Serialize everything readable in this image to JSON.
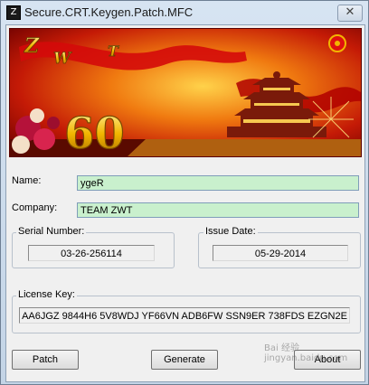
{
  "window": {
    "title": "Secure.CRT.Keygen.Patch.MFC",
    "close_glyph": "✕"
  },
  "banner": {
    "letters": [
      "Z",
      "W",
      "T"
    ],
    "big_number": "60"
  },
  "fields": {
    "name_label": "Name:",
    "name_value": "ygeR",
    "company_label": "Company:",
    "company_value": "TEAM ZWT"
  },
  "serial": {
    "label": "Serial Number:",
    "value": "03-26-256114"
  },
  "issue": {
    "label": "Issue Date:",
    "value": "05-29-2014"
  },
  "license": {
    "label": "License Key:",
    "value": "AA6JGZ 9844H6 5V8WDJ YF66VN ADB6FW SSN9ER 738FDS EZGN2E"
  },
  "buttons": {
    "patch": "Patch",
    "generate": "Generate",
    "about": "About"
  },
  "watermark": "Bai 经验 jingyan.baidu.com",
  "colors": {
    "field_bg": "#c9f0cd",
    "banner_red": "#c00000",
    "banner_gold": "#f2b500"
  }
}
